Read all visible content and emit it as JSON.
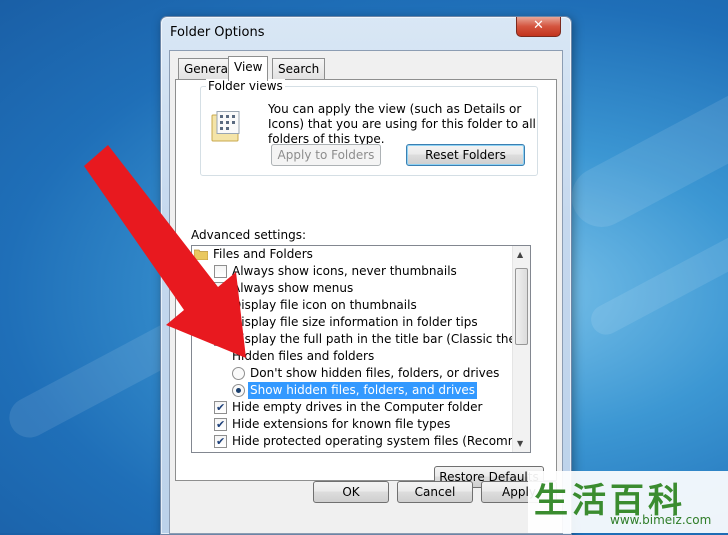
{
  "window": {
    "title": "Folder Options",
    "close_glyph": "✕"
  },
  "tabs": [
    {
      "label": "General"
    },
    {
      "label": "View",
      "active": true
    },
    {
      "label": "Search"
    }
  ],
  "folder_views": {
    "title": "Folder views",
    "description": "You can apply the view (such as Details or Icons) that you are using for this folder to all folders of this type.",
    "apply_button": "Apply to Folders",
    "reset_button": "Reset Folders"
  },
  "advanced": {
    "label": "Advanced settings:",
    "items": [
      {
        "type": "folder",
        "label": "Files and Folders"
      },
      {
        "type": "checkbox",
        "checked": false,
        "label": "Always show icons, never thumbnails"
      },
      {
        "type": "checkbox",
        "checked": false,
        "label": "Always show menus"
      },
      {
        "type": "checkbox",
        "checked": true,
        "label": "Display file icon on thumbnails"
      },
      {
        "type": "checkbox",
        "checked": true,
        "label": "Display file size information in folder tips"
      },
      {
        "type": "checkbox",
        "checked": true,
        "label": "Display the full path in the title bar (Classic theme only)"
      },
      {
        "type": "group",
        "label": "Hidden files and folders"
      },
      {
        "type": "radio",
        "checked": false,
        "label": "Don't show hidden files, folders, or drives"
      },
      {
        "type": "radio",
        "checked": true,
        "selected": true,
        "label": "Show hidden files, folders, and drives"
      },
      {
        "type": "checkbox",
        "checked": true,
        "label": "Hide empty drives in the Computer folder"
      },
      {
        "type": "checkbox",
        "checked": true,
        "label": "Hide extensions for known file types"
      },
      {
        "type": "checkbox",
        "checked": true,
        "label": "Hide protected operating system files (Recommended)"
      }
    ],
    "restore_button": "Restore Defaults"
  },
  "footer": {
    "ok": "OK",
    "cancel": "Cancel",
    "apply": "Apply"
  },
  "watermark": {
    "logo_text": "生活百科",
    "url": "www.bimeiz.com"
  },
  "colors": {
    "selection": "#3399ff",
    "arrow": "#e8191f",
    "desktop": "#2a7fc4"
  }
}
